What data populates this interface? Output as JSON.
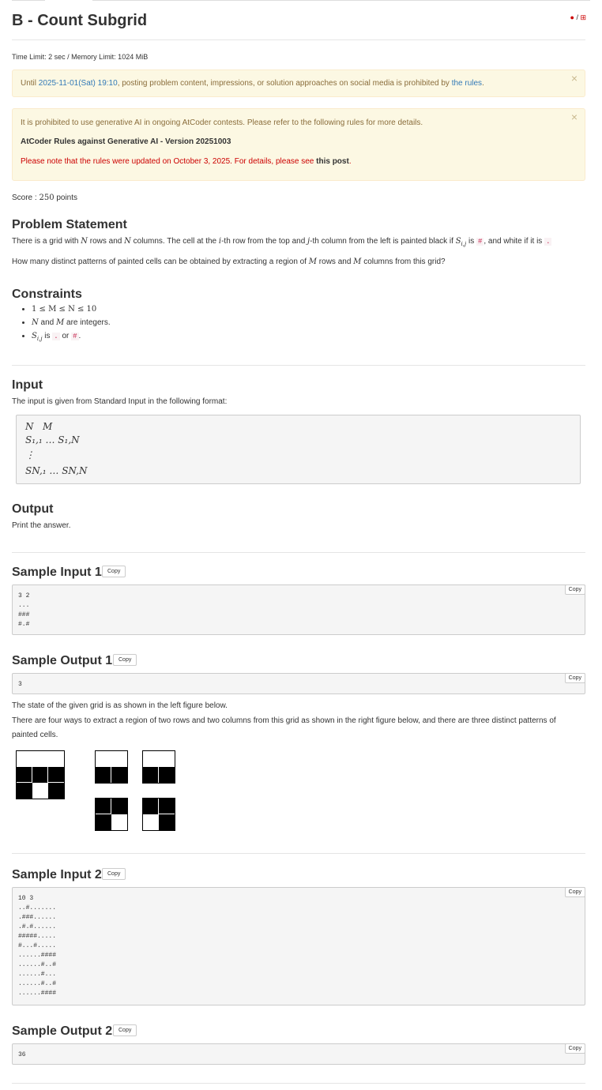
{
  "title": "B - Count Subgrid",
  "lang_switch": {
    "ja": "●",
    "sep": " / ",
    "en": "⊞"
  },
  "limits": "Time Limit: 2 sec / Memory Limit: 1024 MiB",
  "alert1": {
    "pre": "Until ",
    "date": "2025-11-01(Sat) 19:10",
    "mid": ", posting problem content, impressions, or solution approaches on social media is prohibited by ",
    "link": "the rules",
    "post": "."
  },
  "alert2": {
    "line1": "It is prohibited to use generative AI in ongoing AtCoder contests. Please refer to the following rules for more details.",
    "line2": "AtCoder Rules against Generative AI - Version 20251003",
    "line3_pre": "Please note that the rules were updated on October 3, 2025. For details, please see ",
    "line3_link": "this post",
    "line3_post": "."
  },
  "close_glyph": "×",
  "score": {
    "label": "Score : ",
    "value": "250",
    "unit": " points"
  },
  "statement": {
    "heading": "Problem Statement",
    "p1_a": "There is a grid with ",
    "N": "N",
    "p1_b": " rows and ",
    "p1_c": " columns. The cell at the ",
    "i": "i",
    "p1_d": "-th row from the top and ",
    "j": "j",
    "p1_e": "-th column from the left is painted black if ",
    "S": "S",
    "sub_ij": "i,j",
    "p1_f": " is ",
    "hash": "#",
    "p1_g": ", and white if it is ",
    "dot": ".",
    "p1_h": ".",
    "p2_a": "How many distinct patterns of painted cells can be obtained by extracting a region of ",
    "M": "M",
    "p2_b": " rows and ",
    "p2_c": " columns from this grid?"
  },
  "constraints": {
    "heading": "Constraints",
    "c1": "1 ≤ M ≤ N ≤ 10",
    "c2_a": "N",
    "c2_b": " and ",
    "c2_c": "M",
    "c2_d": " are integers.",
    "c3_a": "S",
    "c3_sub": "i,j",
    "c3_b": " is ",
    "c3_dot": ".",
    "c3_c": " or ",
    "c3_hash": "#",
    "c3_d": "."
  },
  "input": {
    "heading": "Input",
    "text": "The input is given from Standard Input in the following format:",
    "fmt1": "N   M",
    "fmt2": "S₁,₁ … S₁,N",
    "fmt3": "⋮",
    "fmt4": "SN,₁ … SN,N"
  },
  "output": {
    "heading": "Output",
    "text": "Print the answer."
  },
  "copy_label": "Copy",
  "sample_in1": {
    "heading": "Sample Input 1",
    "text": "3 2\n...\n###\n#.#"
  },
  "sample_out1": {
    "heading": "Sample Output 1",
    "text": "3",
    "expl1": "The state of the given grid is as shown in the left figure below.",
    "expl2": "There are four ways to extract a region of two rows and two columns from this grid as shown in the right figure below, and there are three distinct patterns of",
    "expl3": "painted cells."
  },
  "sample_in2": {
    "heading": "Sample Input 2",
    "text": "10 3\n..#.......\n.###......\n.#.#......\n#####.....\n#...#.....\n......####\n......#..#\n......#...\n......#..#\n......####"
  },
  "sample_out2": {
    "heading": "Sample Output 2",
    "text": "36"
  }
}
